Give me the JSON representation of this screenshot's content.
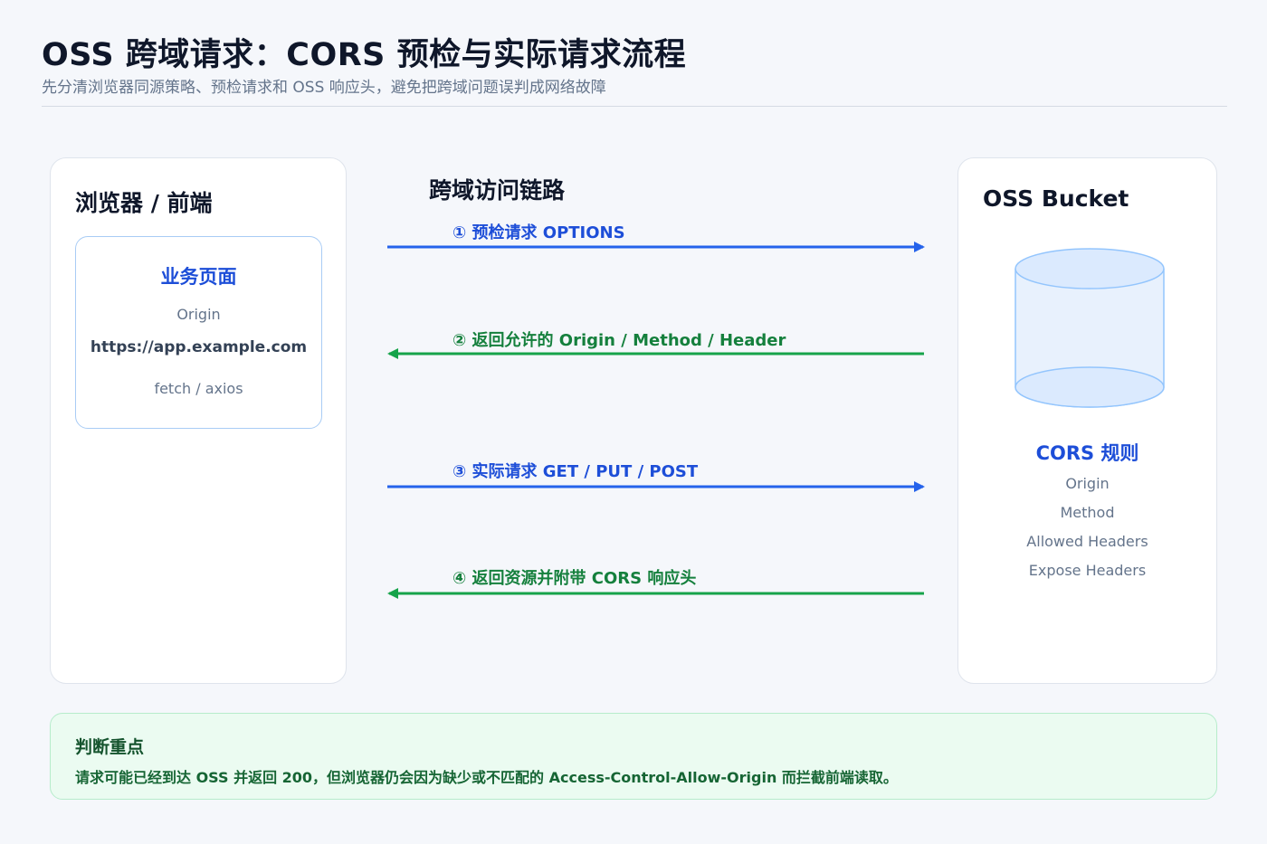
{
  "header": {
    "title": "OSS 跨域请求：CORS 预检与实际请求流程",
    "subtitle": "先分清浏览器同源策略、预检请求和 OSS 响应头，避免把跨域问题误判成网络故障"
  },
  "browser": {
    "title": "浏览器 / 前端",
    "card": {
      "heading": "业务页面",
      "origin_label": "Origin",
      "origin_value": "https://app.example.com",
      "client": "fetch / axios"
    }
  },
  "flow": {
    "heading": "跨域访问链路",
    "steps": [
      {
        "label": "① 预检请求 OPTIONS",
        "direction": "right",
        "color": "#2563eb"
      },
      {
        "label": "② 返回允许的 Origin / Method / Header",
        "direction": "left",
        "color": "#16a34a"
      },
      {
        "label": "③ 实际请求 GET / PUT / POST",
        "direction": "right",
        "color": "#2563eb"
      },
      {
        "label": "④ 返回资源并附带 CORS 响应头",
        "direction": "left",
        "color": "#16a34a"
      }
    ]
  },
  "oss": {
    "title": "OSS Bucket",
    "rules_heading": "CORS 规则",
    "rules": [
      "Origin",
      "Method",
      "Allowed Headers",
      "Expose Headers"
    ]
  },
  "note": {
    "title": "判断重点",
    "text": "请求可能已经到达 OSS 并返回 200，但浏览器仍会因为缺少或不匹配的 Access-Control-Allow-Origin 而拦截前端读取。"
  },
  "colors": {
    "request_arrow": "#2563eb",
    "response_arrow": "#16a34a",
    "accent": "#1d4ed8"
  }
}
